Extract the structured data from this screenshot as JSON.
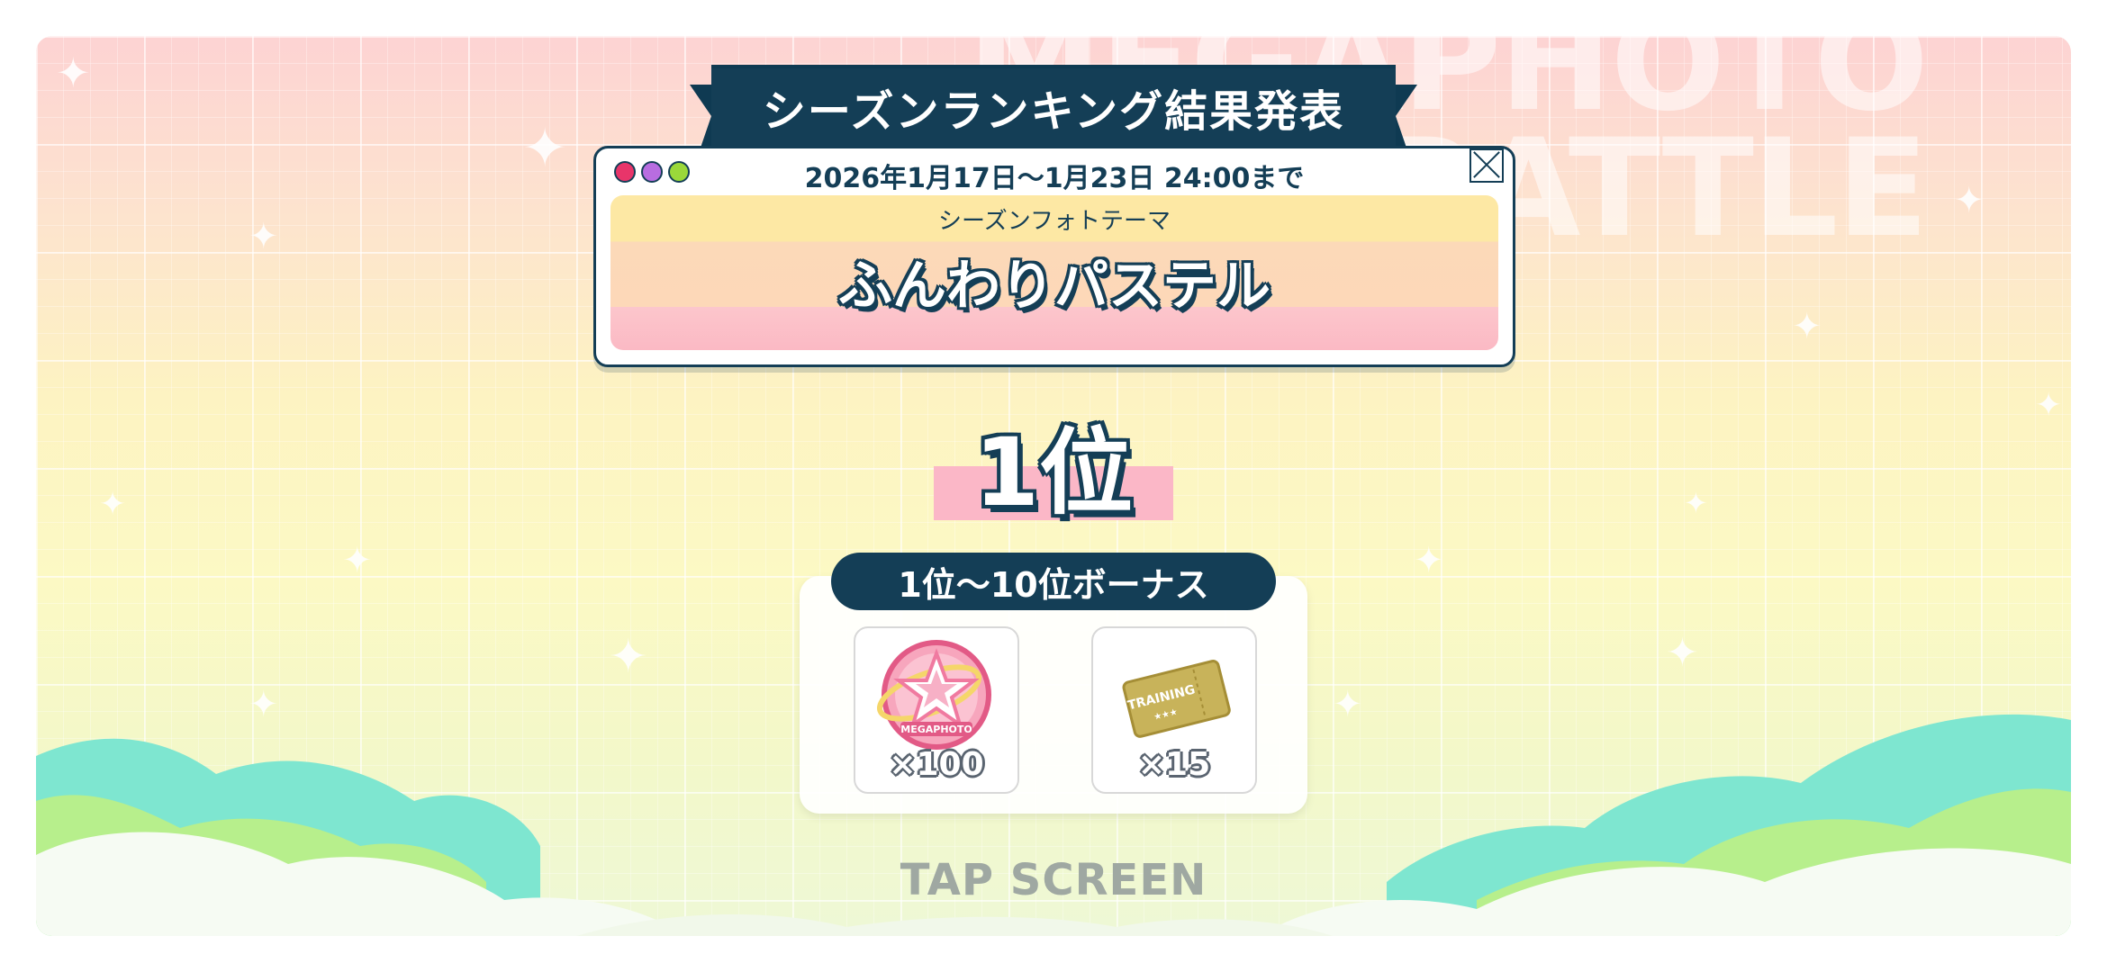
{
  "background": {
    "watermark_line1": "MEGAPHOTO",
    "watermark_line2": "BATTLE"
  },
  "banner": {
    "title": "シーズンランキング結果発表"
  },
  "panel": {
    "period": "2026年1月17日～1月23日 24:00まで",
    "theme_label": "シーズンフォトテーマ",
    "theme_name": "ふんわりパステル",
    "dot_colors": [
      "#e8356a",
      "#b86de0",
      "#9ad83a"
    ]
  },
  "rank": {
    "text": "1位"
  },
  "bonus": {
    "title": "1位～10位ボーナス",
    "items": [
      {
        "icon": "megaphoto-medal-icon",
        "medal_text": "MEGAPHOTO",
        "quantity": "×100"
      },
      {
        "icon": "training-ticket-icon",
        "ticket_text": "TRAINING",
        "ticket_stars": "★★★",
        "quantity": "×15"
      }
    ]
  },
  "footer": {
    "tap_label": "TAP SCREEN"
  }
}
